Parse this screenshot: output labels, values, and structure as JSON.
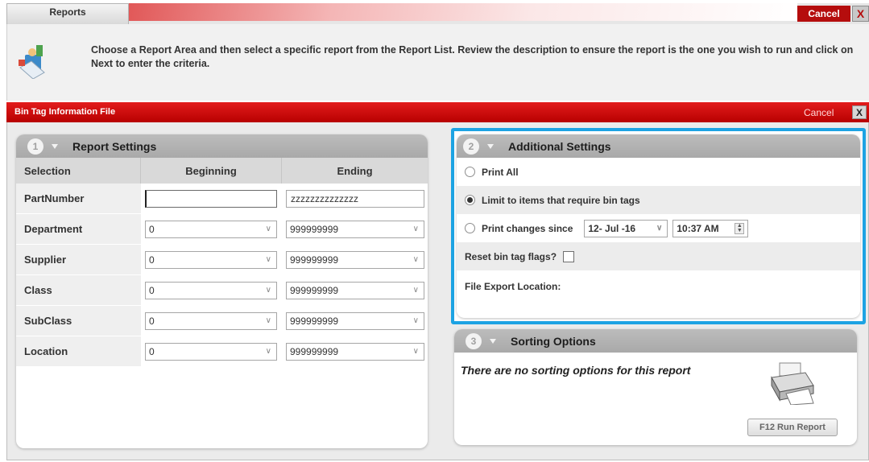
{
  "top": {
    "tab_label": "Reports",
    "cancel_label": "Cancel",
    "close_label": "X"
  },
  "instructions": {
    "text": "Choose a Report Area and then select a specific report from the Report List. Review the description to ensure the report is the one you wish to run and click on Next to enter the criteria.",
    "icon": "report-wizard-icon"
  },
  "window": {
    "title": "Bin Tag Information File",
    "cancel_label": "Cancel",
    "close_label": "X"
  },
  "report_settings": {
    "step": "1",
    "title": "Report Settings",
    "columns": [
      "Selection",
      "Beginning",
      "Ending"
    ],
    "rows": [
      {
        "label": "PartNumber",
        "beginning": "",
        "ending": "zzzzzzzzzzzzzz",
        "type": "text"
      },
      {
        "label": "Department",
        "beginning": "0",
        "ending": "999999999",
        "type": "select"
      },
      {
        "label": "Supplier",
        "beginning": "0",
        "ending": "999999999",
        "type": "select"
      },
      {
        "label": "Class",
        "beginning": "0",
        "ending": "999999999",
        "type": "select"
      },
      {
        "label": "SubClass",
        "beginning": "0",
        "ending": "999999999",
        "type": "select"
      },
      {
        "label": "Location",
        "beginning": "0",
        "ending": "999999999",
        "type": "select"
      }
    ]
  },
  "additional_settings": {
    "step": "2",
    "title": "Additional Settings",
    "print_all_label": "Print All",
    "limit_label": "Limit to items that require bin tags",
    "changes_label": "Print changes since",
    "changes_date": "12- Jul -16",
    "changes_time": "10:37 AM",
    "reset_label": "Reset bin tag flags?",
    "reset_checked": false,
    "file_export_label": "File Export Location:",
    "selected_option": "limit",
    "highlight_color": "#1da3e3"
  },
  "sorting_options": {
    "step": "3",
    "title": "Sorting Options",
    "message": "There are no sorting options for this report",
    "run_button_label": "F12 Run Report",
    "icon": "printer-icon"
  },
  "colors": {
    "brand_red": "#c00000",
    "highlight_blue": "#1da3e3"
  }
}
